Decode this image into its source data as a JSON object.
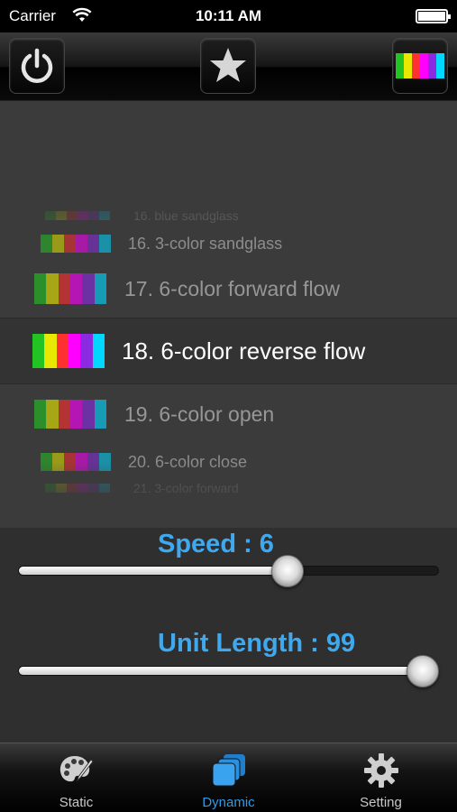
{
  "status_bar": {
    "carrier": "Carrier",
    "time": "10:11 AM"
  },
  "toolbar": {
    "power_icon": "power-icon",
    "favorite_icon": "star-icon",
    "mode_icon": "rainbow-strip-icon"
  },
  "effects": {
    "items": [
      {
        "label": "16. blue sandglass"
      },
      {
        "label": "16. 3-color sandglass"
      },
      {
        "label": "17. 6-color forward flow"
      },
      {
        "label": "18. 6-color reverse flow",
        "selected": true
      },
      {
        "label": "19. 6-color open"
      },
      {
        "label": "20. 6-color close"
      },
      {
        "label": "21. 3-color forward"
      }
    ],
    "rainbow_colors": [
      "#22c322",
      "#e8e800",
      "#ff3030",
      "#ff00ff",
      "#8a2be2",
      "#00d8ff"
    ]
  },
  "controls": {
    "speed": {
      "label": "Speed : 6",
      "value": 6,
      "fraction": 0.66
    },
    "unit_length": {
      "label": "Unit Length : 99",
      "value": 99,
      "fraction": 1.0
    }
  },
  "tabs": [
    {
      "label": "Static",
      "icon": "palette-icon",
      "active": false
    },
    {
      "label": "Dynamic",
      "icon": "layers-icon",
      "active": true
    },
    {
      "label": "Setting",
      "icon": "gear-icon",
      "active": false
    }
  ],
  "colors": {
    "accent": "#3fa9ef",
    "tab_active": "#2f9be6"
  }
}
